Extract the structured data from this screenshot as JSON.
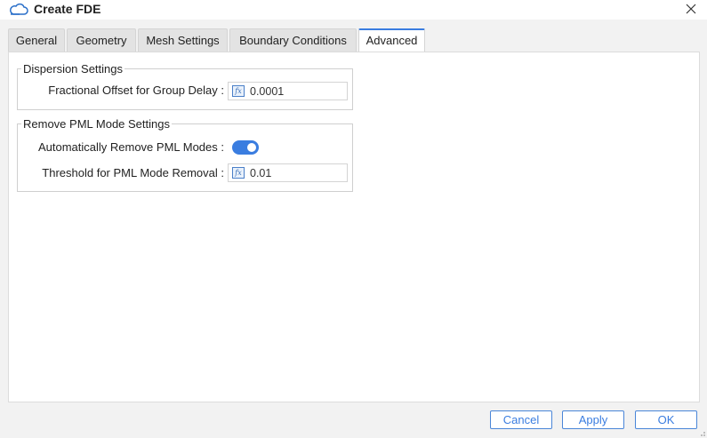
{
  "window": {
    "title": "Create FDE",
    "app_icon": "cloud-icon",
    "close_icon": "close-icon"
  },
  "tabs": [
    {
      "label": "General"
    },
    {
      "label": "Geometry"
    },
    {
      "label": "Mesh Settings"
    },
    {
      "label": "Boundary Conditions"
    },
    {
      "label": "Advanced",
      "active": true
    }
  ],
  "dispersion": {
    "title": "Dispersion Settings",
    "offset_label": "Fractional Offset for Group Delay :",
    "offset_value": "0.0001"
  },
  "pml": {
    "title": "Remove PML Mode Settings",
    "auto_label": "Automatically Remove PML Modes :",
    "auto_enabled": true,
    "threshold_label": "Threshold for PML Mode Removal :",
    "threshold_value": "0.01"
  },
  "buttons": {
    "cancel": "Cancel",
    "apply": "Apply",
    "ok": "OK"
  },
  "colors": {
    "accent": "#3a7de0"
  }
}
